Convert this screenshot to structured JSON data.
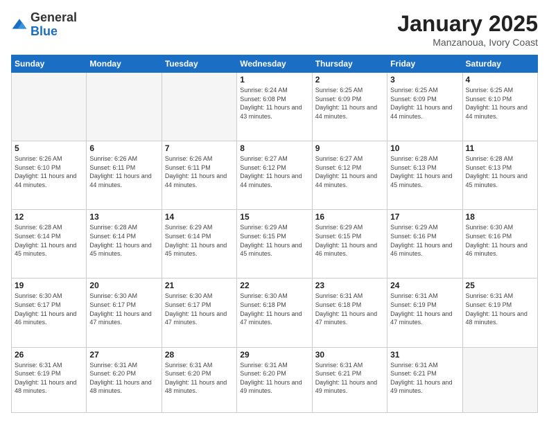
{
  "logo": {
    "general": "General",
    "blue": "Blue"
  },
  "header": {
    "month": "January 2025",
    "location": "Manzanoua, Ivory Coast"
  },
  "weekdays": [
    "Sunday",
    "Monday",
    "Tuesday",
    "Wednesday",
    "Thursday",
    "Friday",
    "Saturday"
  ],
  "weeks": [
    [
      {
        "day": "",
        "empty": true
      },
      {
        "day": "",
        "empty": true
      },
      {
        "day": "",
        "empty": true
      },
      {
        "day": "1",
        "sunrise": "6:24 AM",
        "sunset": "6:08 PM",
        "daylight": "11 hours and 43 minutes."
      },
      {
        "day": "2",
        "sunrise": "6:25 AM",
        "sunset": "6:09 PM",
        "daylight": "11 hours and 44 minutes."
      },
      {
        "day": "3",
        "sunrise": "6:25 AM",
        "sunset": "6:09 PM",
        "daylight": "11 hours and 44 minutes."
      },
      {
        "day": "4",
        "sunrise": "6:25 AM",
        "sunset": "6:10 PM",
        "daylight": "11 hours and 44 minutes."
      }
    ],
    [
      {
        "day": "5",
        "sunrise": "6:26 AM",
        "sunset": "6:10 PM",
        "daylight": "11 hours and 44 minutes."
      },
      {
        "day": "6",
        "sunrise": "6:26 AM",
        "sunset": "6:11 PM",
        "daylight": "11 hours and 44 minutes."
      },
      {
        "day": "7",
        "sunrise": "6:26 AM",
        "sunset": "6:11 PM",
        "daylight": "11 hours and 44 minutes."
      },
      {
        "day": "8",
        "sunrise": "6:27 AM",
        "sunset": "6:12 PM",
        "daylight": "11 hours and 44 minutes."
      },
      {
        "day": "9",
        "sunrise": "6:27 AM",
        "sunset": "6:12 PM",
        "daylight": "11 hours and 44 minutes."
      },
      {
        "day": "10",
        "sunrise": "6:28 AM",
        "sunset": "6:13 PM",
        "daylight": "11 hours and 45 minutes."
      },
      {
        "day": "11",
        "sunrise": "6:28 AM",
        "sunset": "6:13 PM",
        "daylight": "11 hours and 45 minutes."
      }
    ],
    [
      {
        "day": "12",
        "sunrise": "6:28 AM",
        "sunset": "6:14 PM",
        "daylight": "11 hours and 45 minutes."
      },
      {
        "day": "13",
        "sunrise": "6:28 AM",
        "sunset": "6:14 PM",
        "daylight": "11 hours and 45 minutes."
      },
      {
        "day": "14",
        "sunrise": "6:29 AM",
        "sunset": "6:14 PM",
        "daylight": "11 hours and 45 minutes."
      },
      {
        "day": "15",
        "sunrise": "6:29 AM",
        "sunset": "6:15 PM",
        "daylight": "11 hours and 45 minutes."
      },
      {
        "day": "16",
        "sunrise": "6:29 AM",
        "sunset": "6:15 PM",
        "daylight": "11 hours and 46 minutes."
      },
      {
        "day": "17",
        "sunrise": "6:29 AM",
        "sunset": "6:16 PM",
        "daylight": "11 hours and 46 minutes."
      },
      {
        "day": "18",
        "sunrise": "6:30 AM",
        "sunset": "6:16 PM",
        "daylight": "11 hours and 46 minutes."
      }
    ],
    [
      {
        "day": "19",
        "sunrise": "6:30 AM",
        "sunset": "6:17 PM",
        "daylight": "11 hours and 46 minutes."
      },
      {
        "day": "20",
        "sunrise": "6:30 AM",
        "sunset": "6:17 PM",
        "daylight": "11 hours and 47 minutes."
      },
      {
        "day": "21",
        "sunrise": "6:30 AM",
        "sunset": "6:17 PM",
        "daylight": "11 hours and 47 minutes."
      },
      {
        "day": "22",
        "sunrise": "6:30 AM",
        "sunset": "6:18 PM",
        "daylight": "11 hours and 47 minutes."
      },
      {
        "day": "23",
        "sunrise": "6:31 AM",
        "sunset": "6:18 PM",
        "daylight": "11 hours and 47 minutes."
      },
      {
        "day": "24",
        "sunrise": "6:31 AM",
        "sunset": "6:19 PM",
        "daylight": "11 hours and 47 minutes."
      },
      {
        "day": "25",
        "sunrise": "6:31 AM",
        "sunset": "6:19 PM",
        "daylight": "11 hours and 48 minutes."
      }
    ],
    [
      {
        "day": "26",
        "sunrise": "6:31 AM",
        "sunset": "6:19 PM",
        "daylight": "11 hours and 48 minutes."
      },
      {
        "day": "27",
        "sunrise": "6:31 AM",
        "sunset": "6:20 PM",
        "daylight": "11 hours and 48 minutes."
      },
      {
        "day": "28",
        "sunrise": "6:31 AM",
        "sunset": "6:20 PM",
        "daylight": "11 hours and 48 minutes."
      },
      {
        "day": "29",
        "sunrise": "6:31 AM",
        "sunset": "6:20 PM",
        "daylight": "11 hours and 49 minutes."
      },
      {
        "day": "30",
        "sunrise": "6:31 AM",
        "sunset": "6:21 PM",
        "daylight": "11 hours and 49 minutes."
      },
      {
        "day": "31",
        "sunrise": "6:31 AM",
        "sunset": "6:21 PM",
        "daylight": "11 hours and 49 minutes."
      },
      {
        "day": "",
        "empty": true
      }
    ]
  ]
}
